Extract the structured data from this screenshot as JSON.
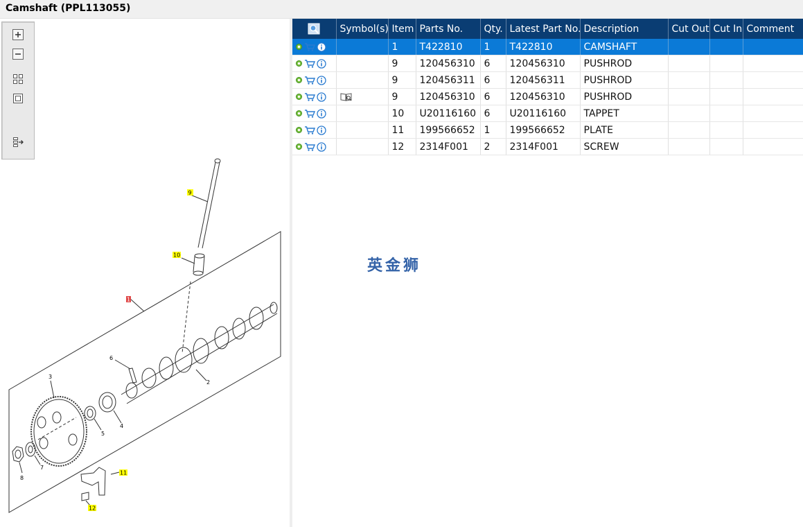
{
  "window": {
    "title": "Camshaft (PPL113055)"
  },
  "toolbox": {
    "tools": [
      {
        "name": "zoom-in-icon"
      },
      {
        "name": "zoom-out-icon"
      },
      {
        "name": "fit-all-icon"
      },
      {
        "name": "fit-window-icon"
      },
      {
        "name": "export-icon"
      }
    ]
  },
  "diagram": {
    "callouts": [
      "9",
      "10",
      "1",
      "6",
      "3",
      "2",
      "5",
      "4",
      "7",
      "8",
      "11",
      "12"
    ]
  },
  "table": {
    "headers": [
      "Symbol(s)",
      "Item",
      "Parts No.",
      "Qty.",
      "Latest Part No.",
      "Description",
      "Cut Out",
      "Cut In",
      "Comment"
    ],
    "rows": [
      {
        "symbol": "",
        "item": "1",
        "parts_no": "T422810",
        "qty": "1",
        "latest": "T422810",
        "description": "CAMSHAFT",
        "cut_out": "",
        "cut_in": "",
        "comment": "",
        "selected": true
      },
      {
        "symbol": "",
        "item": "9",
        "parts_no": "120456310",
        "qty": "6",
        "latest": "120456310",
        "description": "PUSHROD",
        "cut_out": "",
        "cut_in": "",
        "comment": ""
      },
      {
        "symbol": "",
        "item": "9",
        "parts_no": "120456311",
        "qty": "6",
        "latest": "120456311",
        "description": "PUSHROD",
        "cut_out": "",
        "cut_in": "",
        "comment": ""
      },
      {
        "symbol": "book-icon",
        "item": "9",
        "parts_no": "120456310",
        "qty": "6",
        "latest": "120456310",
        "description": "PUSHROD",
        "cut_out": "",
        "cut_in": "",
        "comment": ""
      },
      {
        "symbol": "",
        "item": "10",
        "parts_no": "U20116160",
        "qty": "6",
        "latest": "U20116160",
        "description": "TAPPET",
        "cut_out": "",
        "cut_in": "",
        "comment": ""
      },
      {
        "symbol": "",
        "item": "11",
        "parts_no": "199566652",
        "qty": "1",
        "latest": "199566652",
        "description": "PLATE",
        "cut_out": "",
        "cut_in": "",
        "comment": ""
      },
      {
        "symbol": "",
        "item": "12",
        "parts_no": "2314F001",
        "qty": "2",
        "latest": "2314F001",
        "description": "SCREW",
        "cut_out": "",
        "cut_in": "",
        "comment": ""
      }
    ]
  },
  "watermark": "英金狮",
  "colors": {
    "header_bg": "#0a3d73",
    "selected_bg": "#0b7ad7",
    "callout_highlight": "#ffff00",
    "callout_red": "#e04848"
  }
}
